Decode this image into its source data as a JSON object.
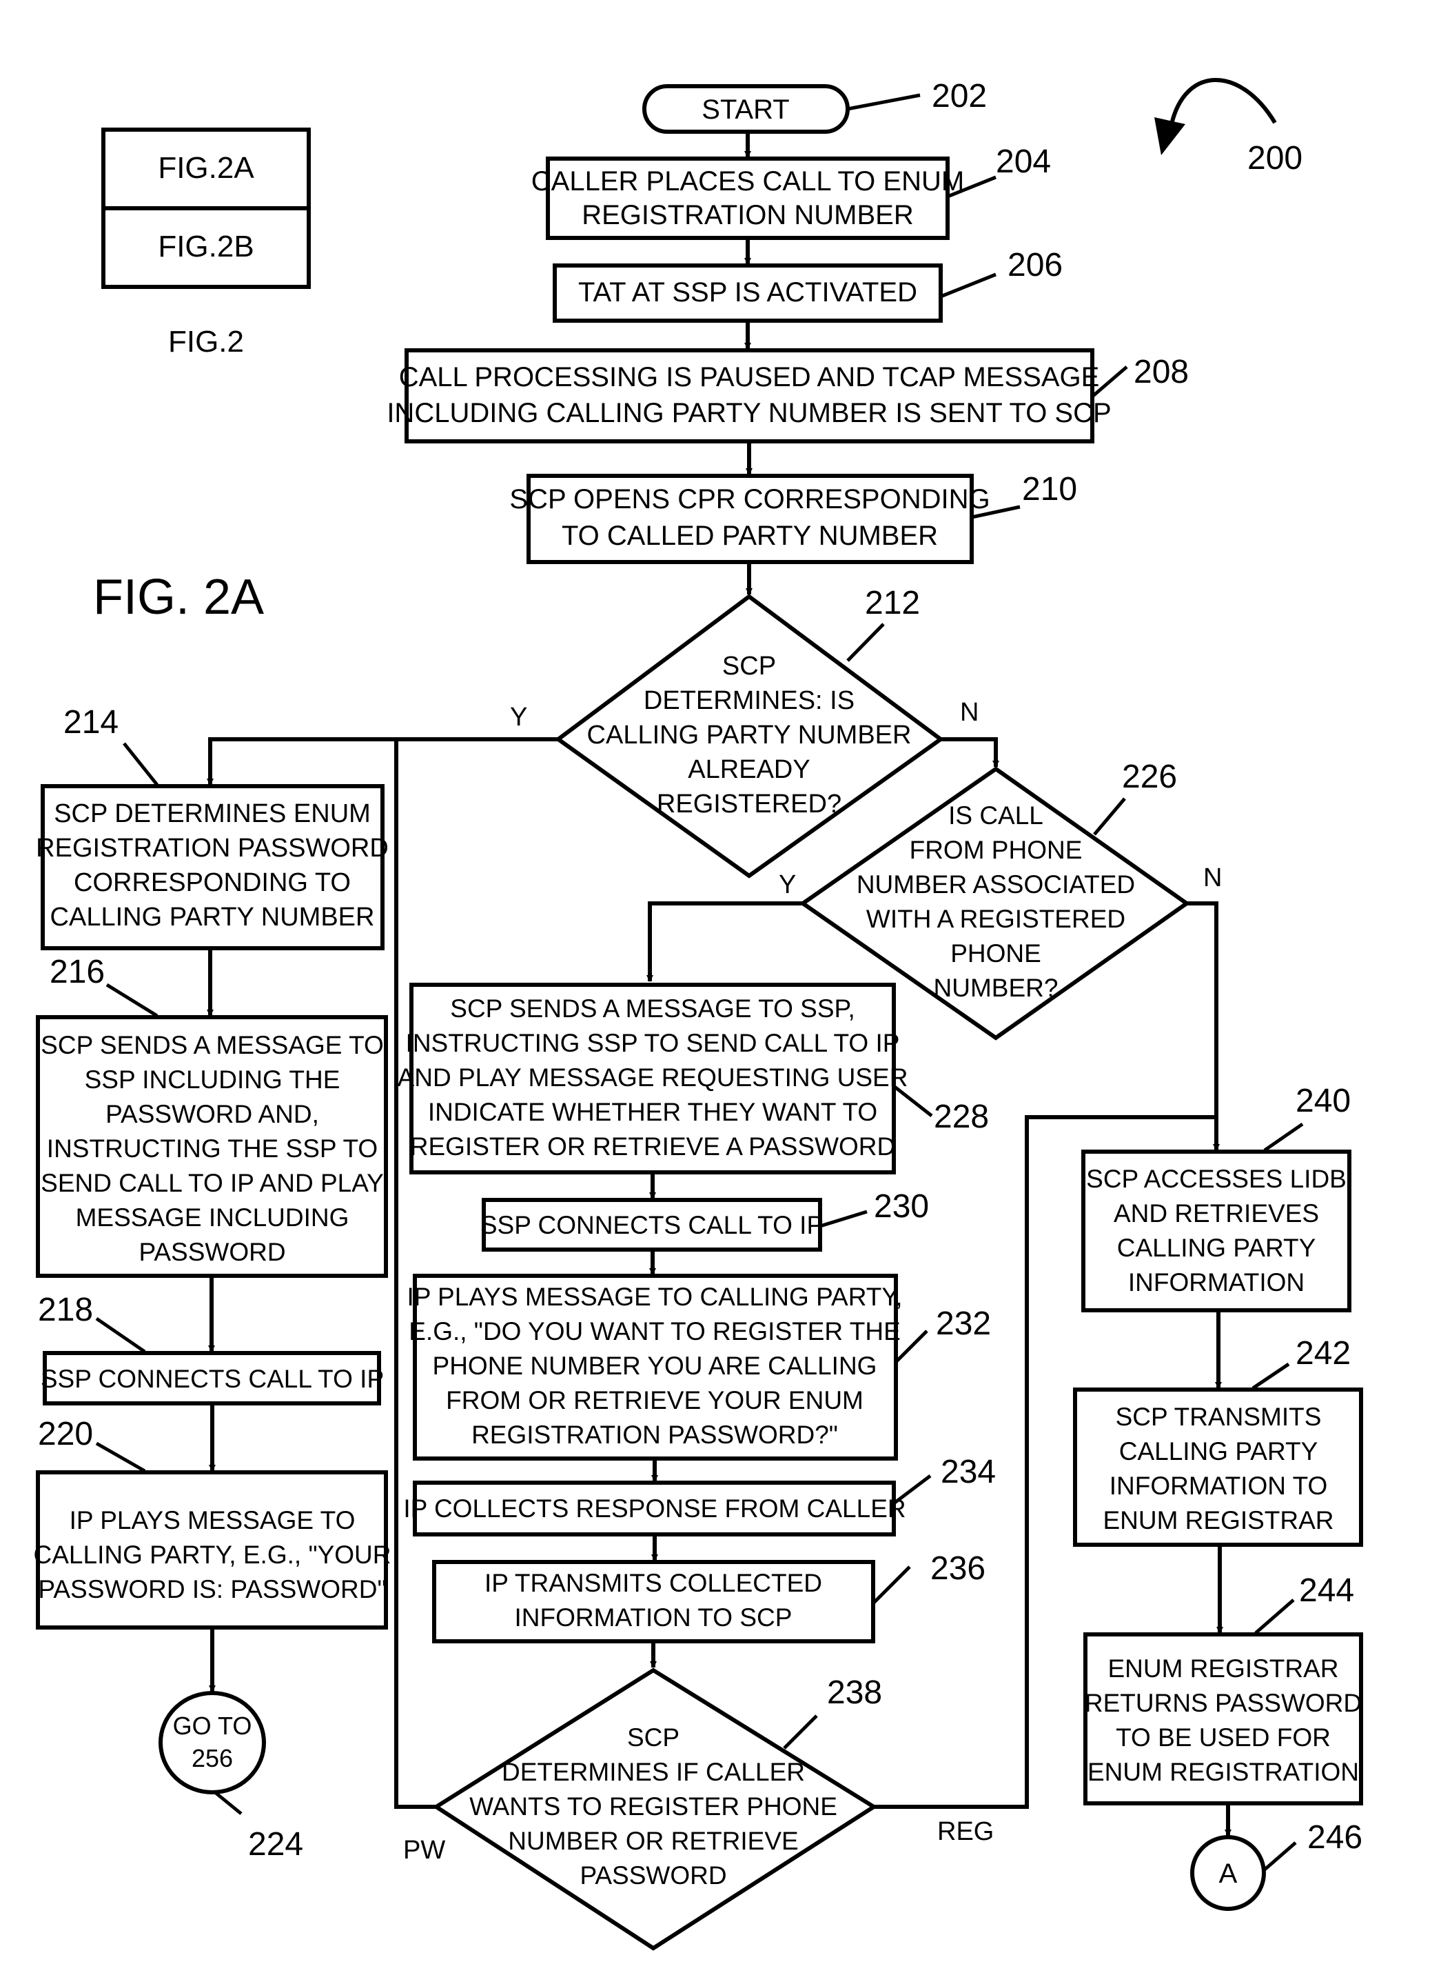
{
  "figure": {
    "title": "FIG. 2A",
    "reference_number": "200",
    "index": {
      "parts": [
        "FIG.2A",
        "FIG.2B"
      ],
      "caption": "FIG.2"
    }
  },
  "nodes": {
    "n202": {
      "ref": "202",
      "type": "terminal",
      "lines": [
        "START"
      ]
    },
    "n204": {
      "ref": "204",
      "type": "process",
      "lines": [
        "CALLER PLACES CALL TO ENUM",
        "REGISTRATION NUMBER"
      ]
    },
    "n206": {
      "ref": "206",
      "type": "process",
      "lines": [
        "TAT AT SSP IS ACTIVATED"
      ]
    },
    "n208": {
      "ref": "208",
      "type": "process",
      "lines": [
        "CALL PROCESSING IS PAUSED AND TCAP MESSAGE",
        "INCLUDING CALLING PARTY NUMBER IS SENT TO SCP"
      ]
    },
    "n210": {
      "ref": "210",
      "type": "process",
      "lines": [
        "SCP OPENS CPR CORRESPONDING",
        "TO CALLED PARTY NUMBER"
      ]
    },
    "n212": {
      "ref": "212",
      "type": "decision",
      "lines": [
        "SCP",
        "DETERMINES: IS",
        "CALLING PARTY NUMBER",
        "ALREADY",
        "REGISTERED?"
      ]
    },
    "n214": {
      "ref": "214",
      "type": "process",
      "lines": [
        "SCP DETERMINES ENUM",
        "REGISTRATION PASSWORD",
        "CORRESPONDING TO",
        "CALLING PARTY NUMBER"
      ]
    },
    "n216": {
      "ref": "216",
      "type": "process",
      "lines": [
        "SCP SENDS A MESSAGE TO",
        "SSP INCLUDING THE",
        "PASSWORD AND,",
        "INSTRUCTING THE SSP TO",
        "SEND CALL TO IP AND PLAY",
        "MESSAGE INCLUDING",
        "PASSWORD"
      ]
    },
    "n218": {
      "ref": "218",
      "type": "process",
      "lines": [
        "SSP CONNECTS CALL TO IP"
      ]
    },
    "n220": {
      "ref": "220",
      "type": "process",
      "lines": [
        "IP PLAYS MESSAGE TO",
        "CALLING PARTY, E.G., \"YOUR",
        "PASSWORD IS: PASSWORD\""
      ]
    },
    "n224": {
      "ref": "224",
      "type": "connector",
      "lines": [
        "GO TO",
        "256"
      ]
    },
    "n226": {
      "ref": "226",
      "type": "decision",
      "lines": [
        "IS CALL",
        "FROM PHONE",
        "NUMBER ASSOCIATED",
        "WITH A REGISTERED",
        "PHONE",
        "NUMBER?"
      ]
    },
    "n228": {
      "ref": "228",
      "type": "process",
      "lines": [
        "SCP SENDS A MESSAGE TO SSP,",
        "INSTRUCTING SSP TO SEND CALL TO IP",
        "AND PLAY MESSAGE REQUESTING USER",
        "INDICATE WHETHER THEY WANT TO",
        "REGISTER OR RETRIEVE A PASSWORD"
      ]
    },
    "n230": {
      "ref": "230",
      "type": "process",
      "lines": [
        "SSP CONNECTS CALL TO IP"
      ]
    },
    "n232": {
      "ref": "232",
      "type": "process",
      "lines": [
        "IP PLAYS MESSAGE TO CALLING PARTY,",
        "E.G., \"DO YOU WANT TO REGISTER THE",
        "PHONE NUMBER YOU ARE CALLING",
        "FROM OR RETRIEVE YOUR ENUM",
        "REGISTRATION PASSWORD?\""
      ]
    },
    "n234": {
      "ref": "234",
      "type": "process",
      "lines": [
        "IP COLLECTS RESPONSE FROM CALLER"
      ]
    },
    "n236": {
      "ref": "236",
      "type": "process",
      "lines": [
        "IP TRANSMITS COLLECTED",
        "INFORMATION TO SCP"
      ]
    },
    "n238": {
      "ref": "238",
      "type": "decision",
      "lines": [
        "SCP",
        "DETERMINES IF CALLER",
        "WANTS TO REGISTER PHONE",
        "NUMBER OR RETRIEVE",
        "PASSWORD"
      ]
    },
    "n240": {
      "ref": "240",
      "type": "process",
      "lines": [
        "SCP ACCESSES LIDB",
        "AND RETRIEVES",
        "CALLING PARTY",
        "INFORMATION"
      ]
    },
    "n242": {
      "ref": "242",
      "type": "process",
      "lines": [
        "SCP TRANSMITS",
        "CALLING PARTY",
        "INFORMATION TO",
        "ENUM REGISTRAR"
      ]
    },
    "n244": {
      "ref": "244",
      "type": "process",
      "lines": [
        "ENUM REGISTRAR",
        "RETURNS PASSWORD",
        "TO BE USED FOR",
        "ENUM REGISTRATION"
      ]
    },
    "n246": {
      "ref": "246",
      "type": "connector",
      "lines": [
        "A"
      ]
    }
  },
  "edge_labels": {
    "e212_yes": "Y",
    "e212_no": "N",
    "e226_yes": "Y",
    "e226_no": "N",
    "e238_pw": "PW",
    "e238_reg": "REG"
  }
}
